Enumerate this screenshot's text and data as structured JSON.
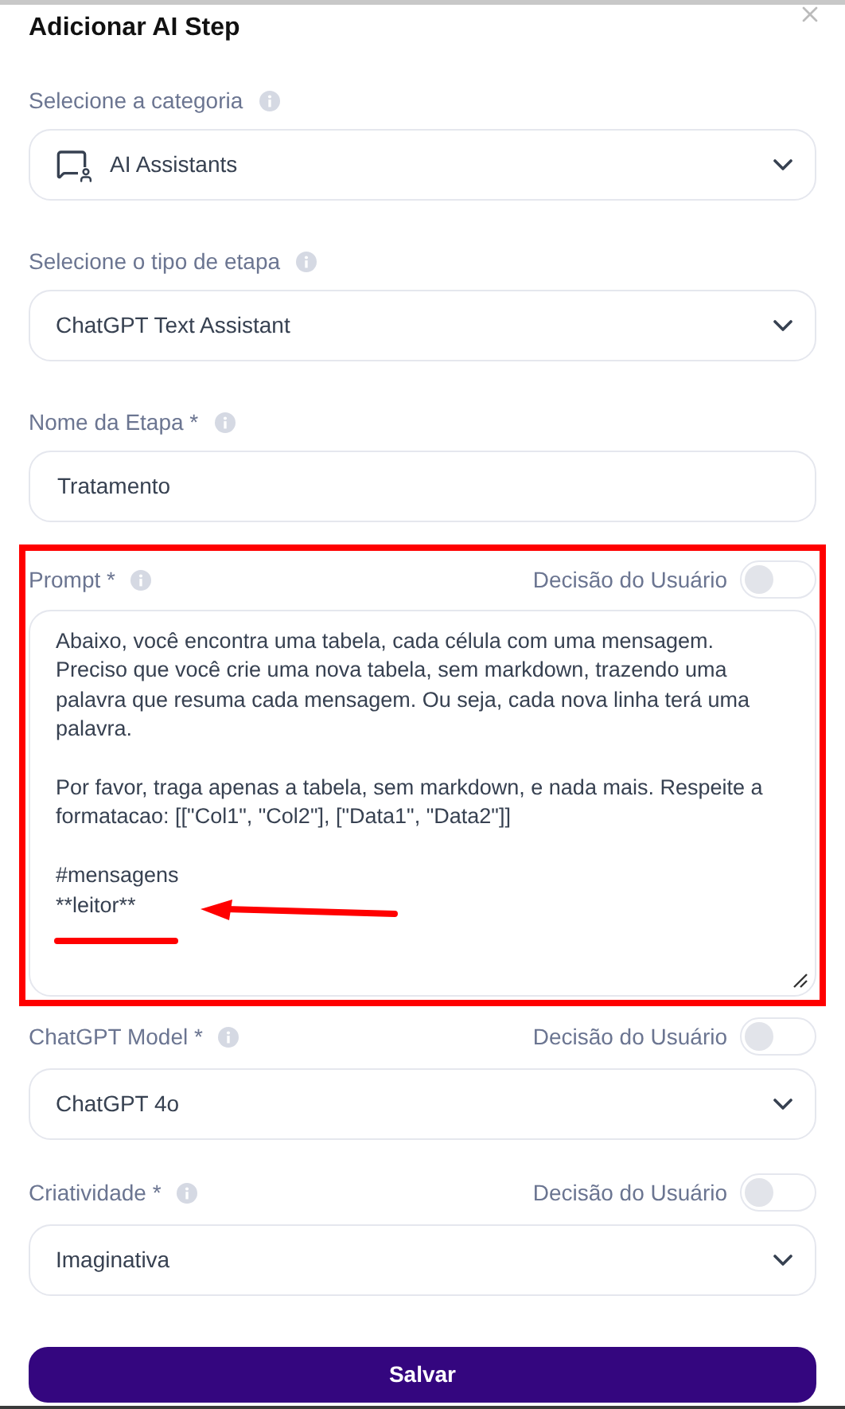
{
  "title": "Adicionar AI Step",
  "fields": [
    {
      "kind": "select",
      "label": "Selecione a categoria",
      "value": "AI Assistants",
      "has_icon": true
    },
    {
      "kind": "select",
      "label": "Selecione o tipo de etapa",
      "value": "ChatGPT Text Assistant",
      "has_icon": false
    },
    {
      "kind": "text",
      "label": "Nome da Etapa *",
      "value": "Tratamento"
    },
    {
      "kind": "textarea",
      "label": "Prompt *",
      "decision": {
        "label": "Decisão do Usuário",
        "on": false
      },
      "value": "Abaixo, você encontra uma tabela, cada célula com uma mensagem. Preciso que você crie uma nova tabela, sem markdown, trazendo uma palavra que resuma cada mensagem. Ou seja, cada nova linha terá uma palavra.\n\nPor favor, traga apenas a tabela, sem markdown, e nada mais. Respeite a formatacao: [[\"Col1\", \"Col2\"], [\"Data1\", \"Data2\"]]\n\n#mensagens\n**leitor**",
      "highlighted": true
    },
    {
      "kind": "select",
      "label": "ChatGPT Model *",
      "decision": {
        "label": "Decisão do Usuário",
        "on": false
      },
      "value": "ChatGPT 4o",
      "has_icon": false
    },
    {
      "kind": "select",
      "label": "Criatividade *",
      "decision": {
        "label": "Decisão do Usuário",
        "on": false
      },
      "value": "Imaginativa",
      "has_icon": false
    }
  ],
  "submit": "Salvar"
}
